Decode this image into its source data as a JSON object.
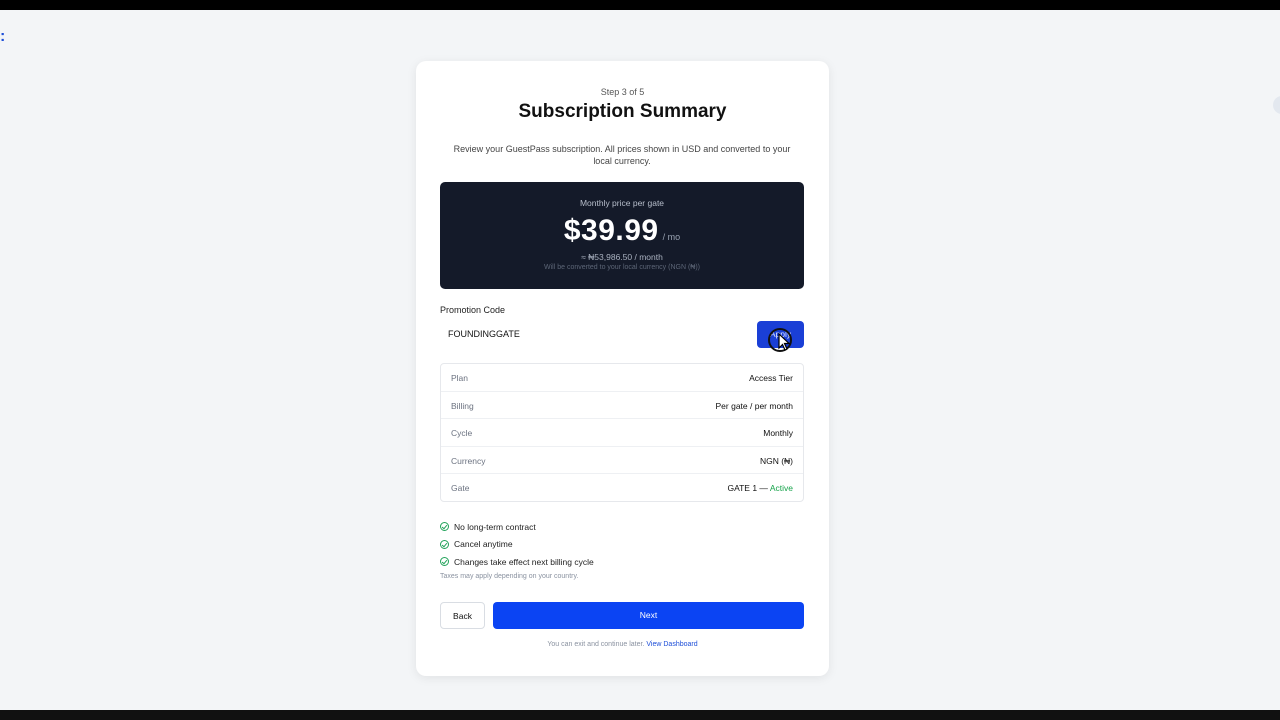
{
  "page": {
    "step": "Step 3 of 5",
    "title": "Subscription Summary",
    "description": "Review your GuestPass subscription. All prices shown in USD and converted to your local currency."
  },
  "price": {
    "label": "Monthly price per gate",
    "amount": "$39.99",
    "unit": "/ mo",
    "local": "≈ ₦53,986.50 / month",
    "note": "Will be converted to your local currency (NGN (₦))"
  },
  "promo": {
    "label": "Promotion Code",
    "value": "FOUNDINGGATE",
    "apply_label": "Apply"
  },
  "details": [
    {
      "key": "Plan",
      "value": "Access Tier"
    },
    {
      "key": "Billing",
      "value": "Per gate / per month"
    },
    {
      "key": "Cycle",
      "value": "Monthly"
    },
    {
      "key": "Currency",
      "value": "NGN (₦)"
    }
  ],
  "gate": {
    "key": "Gate",
    "value": "GATE 1 —",
    "status": "Active",
    "status_color": "#16a34a"
  },
  "features": [
    "No long-term contract",
    "Cancel anytime",
    "Changes take effect next billing cycle"
  ],
  "tax_note": "Taxes may apply depending on your country.",
  "actions": {
    "back_label": "Back",
    "next_label": "Next"
  },
  "footer": {
    "text": "You can exit and continue later.",
    "link": "View Dashboard"
  },
  "colors": {
    "primary": "#0b44f3",
    "dark_panel": "#141a29",
    "success": "#16a34a"
  },
  "icons": [
    "check-circle-icon",
    "mouse-cursor-icon"
  ]
}
